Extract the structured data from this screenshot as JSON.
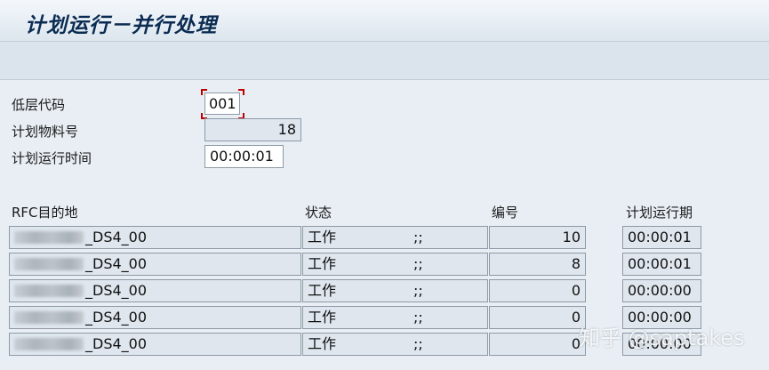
{
  "window": {
    "title": "计划运行－并行处理"
  },
  "form": {
    "low_level_code": {
      "label": "低层代码",
      "value": "001"
    },
    "planned_materials": {
      "label": "计划物料号",
      "value": "18"
    },
    "runtime": {
      "label": "计划运行时间",
      "value": "00:00:01"
    }
  },
  "table": {
    "headers": {
      "rfc_dest": "RFC目的地",
      "status": "状态",
      "number": "编号",
      "runtime": "计划运行期"
    },
    "rows": [
      {
        "dest": "_DS4_00",
        "status": "工作",
        "status_mark": ";;",
        "number": "10",
        "runtime": "00:00:01"
      },
      {
        "dest": "_DS4_00",
        "status": "工作",
        "status_mark": ";;",
        "number": "8",
        "runtime": "00:00:01"
      },
      {
        "dest": "_DS4_00",
        "status": "工作",
        "status_mark": ";;",
        "number": "0",
        "runtime": "00:00:00"
      },
      {
        "dest": "_DS4_00",
        "status": "工作",
        "status_mark": ";;",
        "number": "0",
        "runtime": "00:00:00"
      },
      {
        "dest": "_DS4_00",
        "status": "工作",
        "status_mark": ";;",
        "number": "0",
        "runtime": "00:00:00"
      }
    ]
  },
  "watermark": "知乎 @saptakes"
}
